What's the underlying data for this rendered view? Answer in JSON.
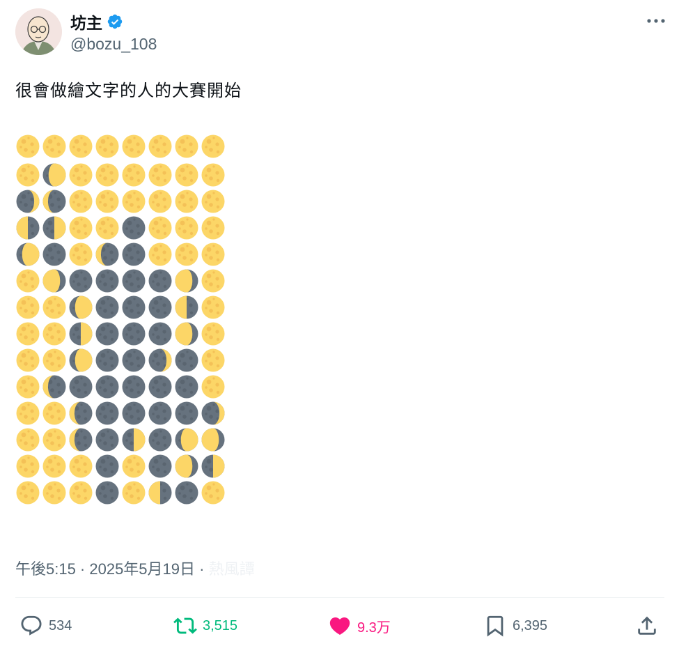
{
  "user": {
    "display_name": "坊主",
    "handle": "@bozu_108",
    "verified": true,
    "avatar_icon": "monk-avatar-icon"
  },
  "post": {
    "text": "很會做繪文字的人的大賽開始",
    "timestamp": "午後5:15 · 2025年5月19日 · ",
    "views_label": "熱風譚"
  },
  "moon_grid": {
    "legend": "F=full moon, N=new moon, Q=first quarter, L=last quarter, G=waxing gibbous, H=waning gibbous, C=waxing crescent, D=waning crescent",
    "rows": [
      [
        "F",
        "F",
        "F",
        "F",
        "F",
        "F",
        "F",
        "F"
      ],
      [
        "F",
        "G",
        "F",
        "F",
        "F",
        "F",
        "F",
        "F"
      ],
      [
        "C",
        "D",
        "F",
        "F",
        "F",
        "F",
        "F",
        "F"
      ],
      [
        "L",
        "Q",
        "F",
        "F",
        "N",
        "F",
        "F",
        "F"
      ],
      [
        "G",
        "N",
        "F",
        "D",
        "N",
        "F",
        "F",
        "F"
      ],
      [
        "F",
        "H",
        "N",
        "N",
        "N",
        "N",
        "H",
        "F"
      ],
      [
        "F",
        "F",
        "G",
        "N",
        "N",
        "N",
        "L",
        "F"
      ],
      [
        "F",
        "F",
        "Q",
        "N",
        "N",
        "N",
        "H",
        "F"
      ],
      [
        "F",
        "F",
        "G",
        "N",
        "N",
        "C",
        "N",
        "F"
      ],
      [
        "F",
        "D",
        "N",
        "N",
        "N",
        "N",
        "N",
        "F"
      ],
      [
        "F",
        "F",
        "D",
        "N",
        "N",
        "N",
        "N",
        "C"
      ],
      [
        "F",
        "F",
        "D",
        "N",
        "Q",
        "N",
        "G",
        "H"
      ],
      [
        "F",
        "F",
        "F",
        "N",
        "F",
        "N",
        "H",
        "Q"
      ],
      [
        "F",
        "F",
        "F",
        "N",
        "F",
        "L",
        "N",
        "F"
      ]
    ],
    "colors": {
      "lit": "#fcd667",
      "lit_spot": "#f4c157",
      "dark": "#66727e",
      "dark_spot": "#5a6570"
    }
  },
  "actions": {
    "reply": {
      "count": "534",
      "icon": "reply-icon"
    },
    "retweet": {
      "count": "3,515",
      "icon": "retweet-icon",
      "color": "#00ba7c"
    },
    "like": {
      "count": "9.3万",
      "icon": "heart-icon",
      "color": "#f91880"
    },
    "bookmark": {
      "count": "6,395",
      "icon": "bookmark-icon"
    },
    "share": {
      "icon": "share-icon"
    }
  },
  "colors": {
    "text": "#0f1419",
    "secondary": "#536471",
    "verified": "#1d9bf0",
    "divider": "#eff3f4"
  }
}
